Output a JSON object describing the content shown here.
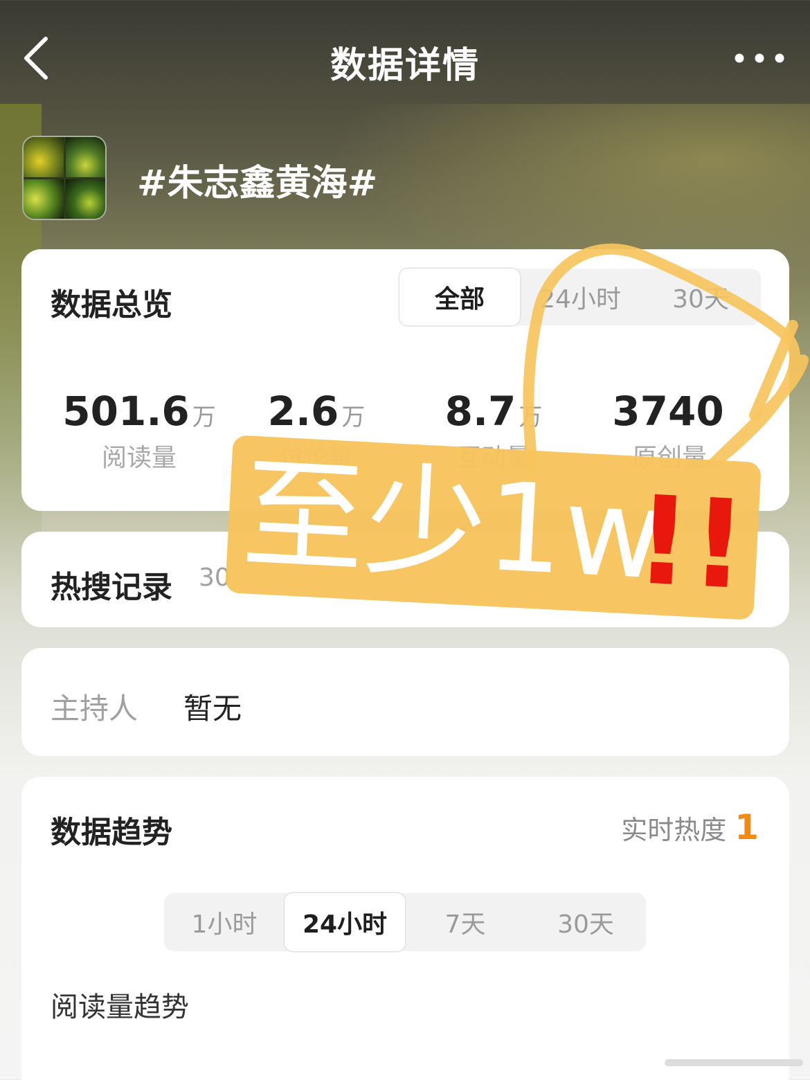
{
  "nav": {
    "title": "数据详情"
  },
  "topic": {
    "title": "#朱志鑫黄海#"
  },
  "overview": {
    "heading": "数据总览",
    "tabs": [
      {
        "label": "全部",
        "active": true
      },
      {
        "label": "24小时",
        "active": false
      },
      {
        "label": "30天",
        "active": false
      }
    ],
    "stats": [
      {
        "value": "501.6",
        "unit": "万",
        "label": "阅读量"
      },
      {
        "value": "2.6",
        "unit": "万",
        "label": "讨论量"
      },
      {
        "value": "8.7",
        "unit": "万",
        "label": "互动量"
      },
      {
        "value": "3740",
        "unit": "",
        "label": "原创量"
      }
    ]
  },
  "hot_search": {
    "heading": "热搜记录",
    "subtitle": "30"
  },
  "host": {
    "label": "主持人",
    "value": "暂无"
  },
  "trend": {
    "heading": "数据趋势",
    "heat_label": "实时热度",
    "heat_value": "1",
    "tabs": [
      {
        "label": "1小时",
        "active": false
      },
      {
        "label": "24小时",
        "active": true
      },
      {
        "label": "7天",
        "active": false
      },
      {
        "label": "30天",
        "active": false
      }
    ],
    "subtitle": "阅读量趋势"
  },
  "annotation": {
    "text": "至少1w",
    "marks": "!!",
    "sticker_color": "#f7c45d",
    "circle_color": "#f7c45d",
    "mark_color": "#e8190c"
  },
  "colors": {
    "accent": "#f08a12"
  }
}
